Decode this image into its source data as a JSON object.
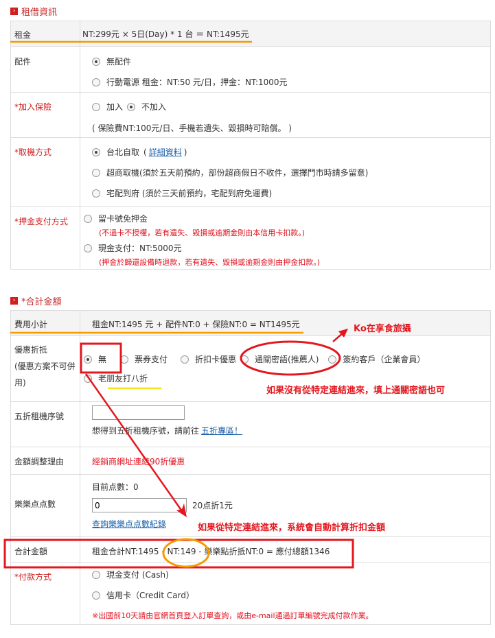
{
  "rental_section": {
    "title": "租借資訊",
    "rent_label": "租金",
    "rent_value": "NT:299元 × 5日(Day) * 1 台 ＝ NT:1495元",
    "accessory_label": "配件",
    "accessory_options": [
      "無配件",
      "行動電源 租金：NT:50 元/日，押金：NT:1000元"
    ],
    "insurance_label": "*加入保險",
    "insurance_options": [
      "加入",
      "不加入"
    ],
    "insurance_note": "( 保險費NT:100元/日、手機若遺失、毀損時可賠償。 )",
    "pickup_label": "*取機方式",
    "pickup_option_1": "台北自取",
    "pickup_detail_link": "詳細資料",
    "pickup_option_2": "超商取機(須於五天前預約，部份超商假日不收件，選擇門市時請多留意)",
    "pickup_option_3": "宅配到府 (須於三天前預約，宅配到府免運費)",
    "deposit_label": "*押金支付方式",
    "deposit_option_1": "留卡號免押金",
    "deposit_note_1": "(不過卡不授權，若有遺失、毀損或逾期金則由本信用卡扣款。)",
    "deposit_option_2": "現金支付：NT:5000元",
    "deposit_note_2": "(押金於歸還設備時退款，若有遺失、毀損或逾期金則由押金扣款。)"
  },
  "total_section": {
    "title": "*合計金額",
    "subtotal_label": "費用小計",
    "subtotal_value": "租金NT:1495 元 + 配件NT:0 + 保險NT:0 = NT1495元",
    "discount_label": "優惠折抵",
    "discount_label_note": "(優惠方案不可併用)",
    "discount_options": [
      "無",
      "票券支付",
      "折扣卡優惠",
      "通關密語(推薦人)",
      "簽約客戶（企業會員）"
    ],
    "discount_option_friend": "老朋友打八折",
    "half_price_label": "五折租機序號",
    "half_price_input_value": "",
    "half_price_note_prefix": "想得到五折租機序號，請前往",
    "half_price_link": "五折專區！",
    "adjust_label": "金額調整理由",
    "adjust_value": "經銷商網址連結90折優惠",
    "points_label": "樂樂点点數",
    "points_current": "目前点數：0",
    "points_input_value": "0",
    "points_rate": "20点折1元",
    "points_query_link": "查詢樂樂点点數紀錄",
    "grand_total_label": "合計金額",
    "grand_total_part_1": "租金合計NT:1495",
    "grand_total_part_2": " - NT:149 - ",
    "grand_total_part_3": "樂樂點折抵NT:0 = 應付總額1346",
    "payment_label": "*付款方式",
    "payment_options": [
      "現金支付 (Cash)",
      "信用卡（Credit Card）"
    ],
    "payment_note": "※出國前10天請由官網首頁登入訂單查詢，或由e-mail通過訂單編號完成付款作業。"
  },
  "annotations": {
    "ko_text": "Ko在享食旅攝",
    "password_note": "如果沒有從特定連結進來，填上通關密語也可",
    "auto_calc_note": "如果從特定連結進來，系統會自動計算折扣金額"
  },
  "colors": {
    "annotation_red": "#e3171e",
    "highlight_orange": "#f59b00",
    "highlight_yellow": "#f2e61b"
  }
}
